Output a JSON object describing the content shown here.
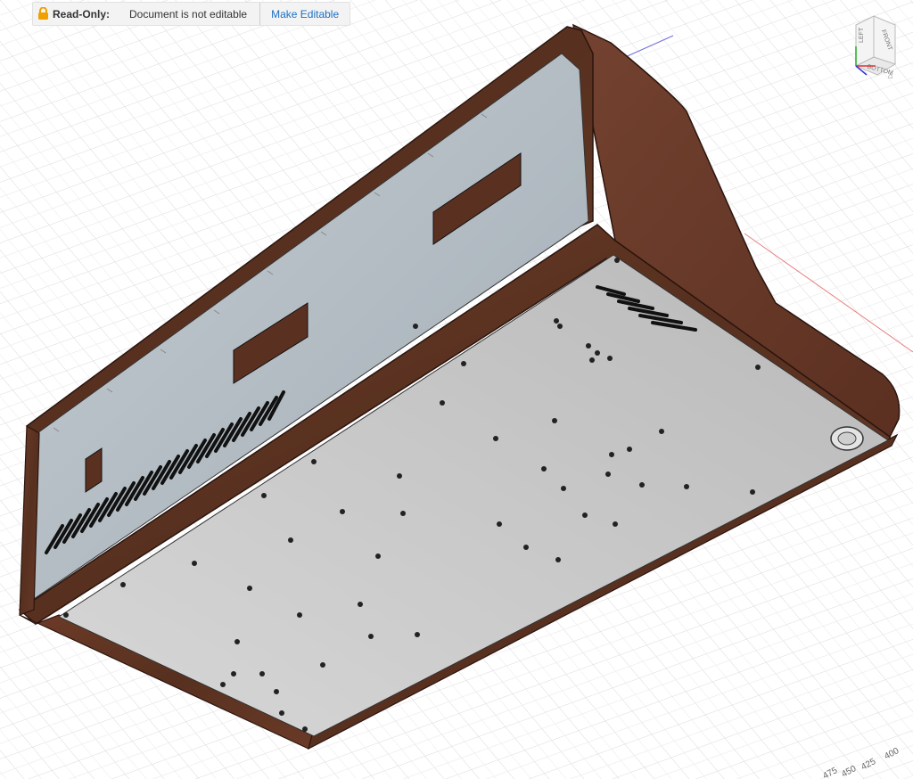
{
  "banner": {
    "status_label": "Read-Only:",
    "message": "Document is not editable",
    "action_label": "Make Editable"
  },
  "viewcube": {
    "faces": [
      "LEFT",
      "FRONT",
      "BOTTOM"
    ]
  },
  "ruler": {
    "ticks": [
      "400",
      "425",
      "450",
      "475"
    ]
  },
  "colors": {
    "wood": "#5e3222",
    "panel": "#a9b4bc",
    "plate": "#c9c9c9",
    "grid": "#d8d8d8",
    "accent": "#1b6fc4"
  },
  "icons": {
    "lock": "lock-icon",
    "cube": "viewcube-icon"
  }
}
